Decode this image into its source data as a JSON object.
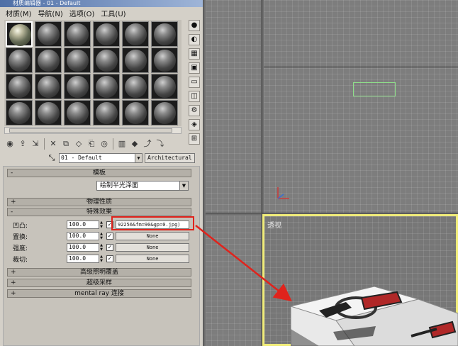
{
  "window": {
    "title": "材质编辑器 - 01 - Default"
  },
  "menu": [
    "材质(M)",
    "导航(N)",
    "选项(O)",
    "工具(U)"
  ],
  "slots": {
    "rows": 4,
    "cols": 6,
    "active_index": 0
  },
  "side_toolbar_icons": [
    "sample-sphere-icon",
    "backlight-icon",
    "checker-background-icon",
    "sample-uv-tiling-icon",
    "video-color-check-icon",
    "make-preview-icon",
    "options-icon",
    "select-by-material-icon",
    "material-navigator-icon"
  ],
  "toolbar_icons": [
    "get-material-icon",
    "put-to-scene-icon",
    "assign-to-selection-icon",
    "reset-map-icon",
    "copy-material-icon",
    "make-unique-icon",
    "put-to-library-icon",
    "material-effects-channel-icon",
    "show-map-in-viewport-icon",
    "show-end-result-icon",
    "go-to-parent-icon",
    "go-forward-to-sibling-icon"
  ],
  "material": {
    "name": "01 - Default",
    "type": "Architectural"
  },
  "rollouts": {
    "templates": {
      "sign": "-",
      "title": "模板",
      "template_value": "绘制半光泽面"
    },
    "physical": {
      "sign": "+",
      "title": "物理性质"
    },
    "special": {
      "sign": "-",
      "title": "特殊效果"
    },
    "advanced_lighting": {
      "sign": "+",
      "title": "高级照明覆盖"
    },
    "supersampling": {
      "sign": "+",
      "title": "超级采样"
    },
    "mental_ray": {
      "sign": "+",
      "title": "mental ray 连接"
    }
  },
  "special_maps": [
    {
      "label": "凹凸:",
      "amount": "100.0",
      "checked": true,
      "map": "92256&fm=90&gp=0.jpg)",
      "assigned": true
    },
    {
      "label": "置换:",
      "amount": "100.0",
      "checked": true,
      "map": "None",
      "assigned": false
    },
    {
      "label": "强度:",
      "amount": "100.0",
      "checked": true,
      "map": "None",
      "assigned": false
    },
    {
      "label": "裁切:",
      "amount": "100.0",
      "checked": true,
      "map": "None",
      "assigned": false
    }
  ],
  "viewports": {
    "perspective_label": "透视"
  },
  "colors": {
    "highlight_red": "#e0231c",
    "active_viewport_border": "#f0ec7a",
    "selection_box": "#8fe08a"
  }
}
